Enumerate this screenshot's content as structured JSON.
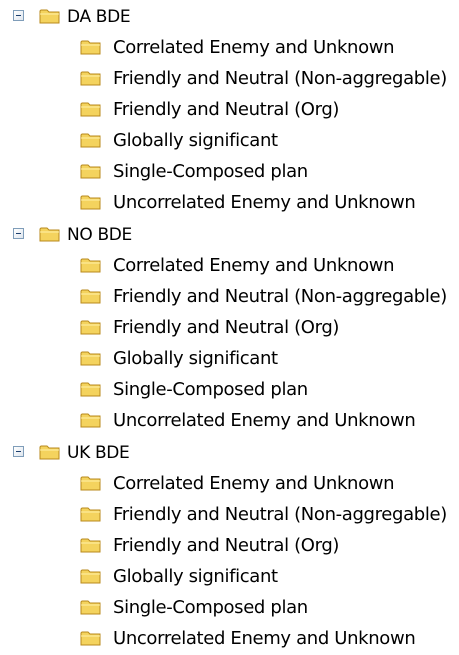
{
  "tree": {
    "groups": [
      {
        "label": "DA BDE",
        "children": [
          "Correlated Enemy and Unknown",
          "Friendly and Neutral (Non-aggregable)",
          "Friendly and Neutral (Org)",
          "Globally significant",
          "Single-Composed plan",
          "Uncorrelated Enemy and Unknown"
        ]
      },
      {
        "label": "NO BDE",
        "children": [
          "Correlated Enemy and Unknown",
          "Friendly and Neutral (Non-aggregable)",
          "Friendly and Neutral (Org)",
          "Globally significant",
          "Single-Composed plan",
          "Uncorrelated Enemy and Unknown"
        ]
      },
      {
        "label": "UK BDE",
        "children": [
          "Correlated Enemy and Unknown",
          "Friendly and Neutral (Non-aggregable)",
          "Friendly and Neutral (Org)",
          "Globally significant",
          "Single-Composed plan",
          "Uncorrelated Enemy and Unknown"
        ]
      }
    ],
    "icons": {
      "expander": "minus-box-icon",
      "folder": "folder-icon"
    },
    "colors": {
      "folder_fill": "#f4d35e",
      "folder_stroke": "#b88a1c",
      "expander_border": "#7f9db9"
    }
  }
}
